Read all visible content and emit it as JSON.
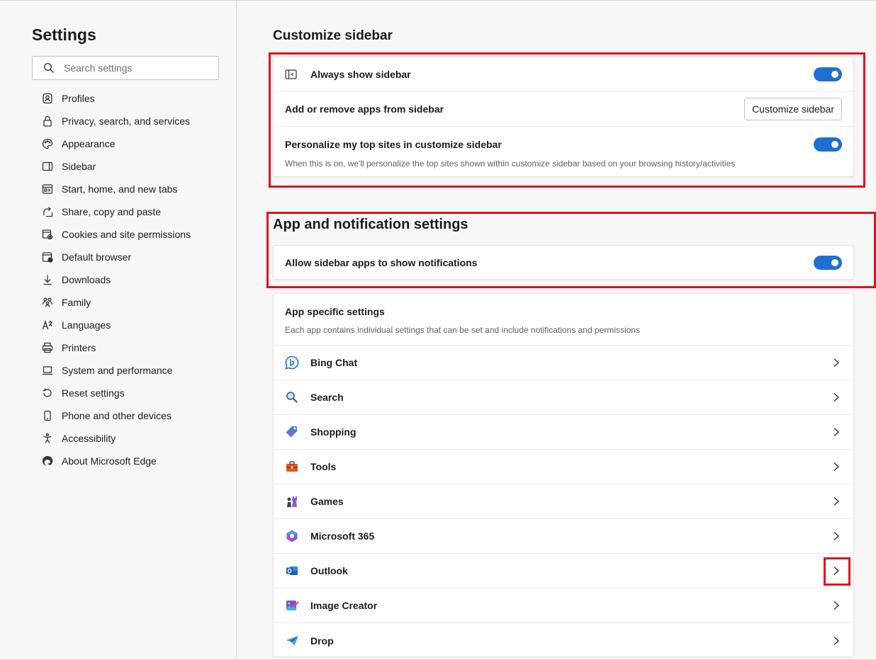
{
  "nav": {
    "title": "Settings",
    "search_placeholder": "Search settings",
    "items": [
      {
        "label": "Profiles",
        "icon": "profile-icon"
      },
      {
        "label": "Privacy, search, and services",
        "icon": "lock-icon"
      },
      {
        "label": "Appearance",
        "icon": "palette-icon"
      },
      {
        "label": "Sidebar",
        "icon": "sidebar-icon"
      },
      {
        "label": "Start, home, and new tabs",
        "icon": "home-tabs-icon"
      },
      {
        "label": "Share, copy and paste",
        "icon": "share-icon"
      },
      {
        "label": "Cookies and site permissions",
        "icon": "cookies-icon"
      },
      {
        "label": "Default browser",
        "icon": "browser-icon"
      },
      {
        "label": "Downloads",
        "icon": "download-icon"
      },
      {
        "label": "Family",
        "icon": "family-icon"
      },
      {
        "label": "Languages",
        "icon": "languages-icon"
      },
      {
        "label": "Printers",
        "icon": "printer-icon"
      },
      {
        "label": "System and performance",
        "icon": "laptop-icon"
      },
      {
        "label": "Reset settings",
        "icon": "reset-icon"
      },
      {
        "label": "Phone and other devices",
        "icon": "phone-icon"
      },
      {
        "label": "Accessibility",
        "icon": "accessibility-icon"
      },
      {
        "label": "About Microsoft Edge",
        "icon": "edge-logo-icon"
      }
    ]
  },
  "customize": {
    "heading": "Customize sidebar",
    "always_show": "Always show sidebar",
    "add_remove": "Add or remove apps from sidebar",
    "customize_button": "Customize sidebar",
    "personalize": "Personalize my top sites in customize sidebar",
    "personalize_desc": "When this is on, we'll personalize the top sites shown within customize sidebar based on your browsing history/activities"
  },
  "appnotif": {
    "heading": "App and notification settings",
    "allow_notifications": "Allow sidebar apps to show notifications"
  },
  "appspecific": {
    "title": "App specific settings",
    "desc": "Each app contains individual settings that can be set and include notifications and permissions",
    "apps": [
      {
        "label": "Bing Chat",
        "icon": "bing-chat-icon"
      },
      {
        "label": "Search",
        "icon": "search-icon"
      },
      {
        "label": "Shopping",
        "icon": "shopping-tag-icon"
      },
      {
        "label": "Tools",
        "icon": "toolbox-icon"
      },
      {
        "label": "Games",
        "icon": "chess-icon"
      },
      {
        "label": "Microsoft 365",
        "icon": "microsoft-365-icon"
      },
      {
        "label": "Outlook",
        "icon": "outlook-icon"
      },
      {
        "label": "Image Creator",
        "icon": "image-creator-icon"
      },
      {
        "label": "Drop",
        "icon": "drop-icon"
      }
    ]
  },
  "colors": {
    "toggle_on": "#1f6fd1",
    "highlight": "#e0111d"
  }
}
